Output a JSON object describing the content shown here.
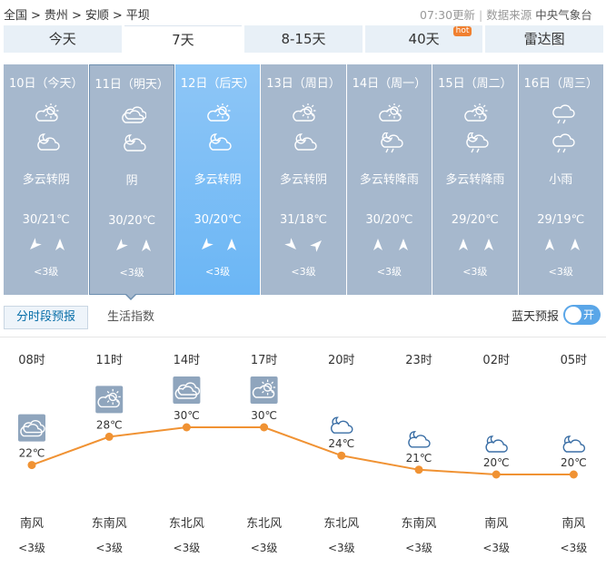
{
  "breadcrumb": {
    "items": [
      "全国",
      "贵州",
      "安顺",
      "平坝"
    ],
    "sep": ">"
  },
  "update": {
    "time": "07:30更新",
    "source_label": "数据来源",
    "source": "中央气象台"
  },
  "tabs": [
    {
      "label": "今天",
      "active": false
    },
    {
      "label": "7天",
      "active": true
    },
    {
      "label": "8-15天",
      "active": false
    },
    {
      "label": "40天",
      "active": false,
      "badge": "hot"
    },
    {
      "label": "雷达图",
      "active": false
    }
  ],
  "days": [
    {
      "name": "10日（今天）",
      "icon1": "partly-cloudy-icon",
      "icon2": "cloudy-night-icon",
      "desc": "多云转阴",
      "temp": "30/21℃",
      "wind1": "sw-arrow",
      "wind2": "n-arrow",
      "level": "<3级"
    },
    {
      "name": "11日（明天）",
      "icon1": "overcast-icon",
      "icon2": "cloudy-night-icon",
      "desc": "阴",
      "temp": "30/20℃",
      "wind1": "sw-arrow",
      "wind2": "n-arrow",
      "level": "<3级"
    },
    {
      "name": "12日（后天）",
      "icon1": "partly-cloudy-icon",
      "icon2": "cloudy-night-icon",
      "desc": "多云转阴",
      "temp": "30/20℃",
      "wind1": "sw-arrow",
      "wind2": "n-arrow",
      "level": "<3级"
    },
    {
      "name": "13日（周日）",
      "icon1": "partly-cloudy-icon",
      "icon2": "cloudy-night-icon",
      "desc": "多云转阴",
      "temp": "31/18℃",
      "wind1": "se-arrow",
      "wind2": "ne-arrow",
      "level": "<3级"
    },
    {
      "name": "14日（周一）",
      "icon1": "partly-cloudy-icon",
      "icon2": "rain-night-icon",
      "desc": "多云转降雨",
      "temp": "30/20℃",
      "wind1": "n-arrow",
      "wind2": "n-arrow",
      "level": "<3级"
    },
    {
      "name": "15日（周二）",
      "icon1": "partly-cloudy-icon",
      "icon2": "rain-night-icon",
      "desc": "多云转降雨",
      "temp": "29/20℃",
      "wind1": "n-arrow",
      "wind2": "n-arrow",
      "level": "<3级"
    },
    {
      "name": "16日（周三）",
      "icon1": "rain-icon",
      "icon2": "rain-icon",
      "desc": "小雨",
      "temp": "29/19℃",
      "wind1": "n-arrow",
      "wind2": "n-arrow",
      "level": "<3级"
    }
  ],
  "subtabs": {
    "hourly": "分时段预报",
    "life": "生活指数"
  },
  "blue_sky": {
    "label": "蓝天预报",
    "toggle": "开"
  },
  "hourly": {
    "hours": [
      "08时",
      "11时",
      "14时",
      "17时",
      "20时",
      "23时",
      "02时",
      "05时"
    ],
    "temps": [
      22,
      28,
      30,
      30,
      24,
      21,
      20,
      20
    ],
    "temp_labels": [
      "22℃",
      "28℃",
      "30℃",
      "30℃",
      "24℃",
      "21℃",
      "20℃",
      "20℃"
    ],
    "icons": [
      "overcast-icon",
      "partly-cloudy-icon",
      "overcast-icon",
      "partly-cloudy-icon",
      "cloudy-night-icon",
      "cloudy-night-icon",
      "cloudy-night-icon",
      "cloudy-night-icon"
    ],
    "winds": [
      "南风",
      "东南风",
      "东北风",
      "东北风",
      "东北风",
      "东南风",
      "南风",
      "南风"
    ],
    "levels": [
      "<3级",
      "<3级",
      "<3级",
      "<3级",
      "<3级",
      "<3级",
      "<3级",
      "<3级"
    ]
  },
  "colors": {
    "card": "#a6b8cd",
    "card_highlight": "#6bb6f5",
    "line": "#f09233",
    "tab_bg": "#e8f0f7",
    "toggle": "#5aa6e8"
  }
}
